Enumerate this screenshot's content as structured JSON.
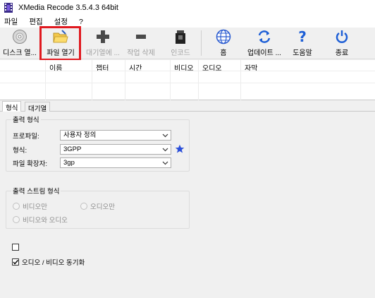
{
  "window": {
    "title": "XMedia Recode 3.5.4.3 64bit"
  },
  "menu": {
    "items": [
      "파일",
      "편집",
      "설정",
      "?"
    ]
  },
  "toolbar": {
    "disc_open": "디스크 열...",
    "file_open": "파일 열기",
    "add_queue": "대기열에 ...",
    "delete_job": "작업 삭제",
    "encode": "인코드",
    "home": "홈",
    "update": "업데이트 ...",
    "help": "도움말",
    "exit": "종료"
  },
  "file_table": {
    "columns": [
      "",
      "이름",
      "챕터",
      "시간",
      "비디오",
      "오디오",
      "자막"
    ]
  },
  "tabs": {
    "format": "형식",
    "queue": "대기열"
  },
  "output_format": {
    "group_title": "출력 형식",
    "profile_label": "프로파일:",
    "profile_value": "사용자 정의",
    "format_label": "형식:",
    "format_value": "3GPP",
    "ext_label": "파일 확장자:",
    "ext_value": "3gp"
  },
  "stream_format": {
    "group_title": "출력 스트림 형식",
    "video_only": "비디오만",
    "audio_only": "오디오만",
    "video_audio": "비디오와 오디오"
  },
  "options": {
    "unlabeled_checked": false,
    "av_sync_label": "오디오 / 비디오 동기화",
    "av_sync_checked": true
  },
  "colors": {
    "highlight": "#e0191f",
    "accent_blue": "#1e5fd6",
    "star": "#2b4fd9"
  }
}
